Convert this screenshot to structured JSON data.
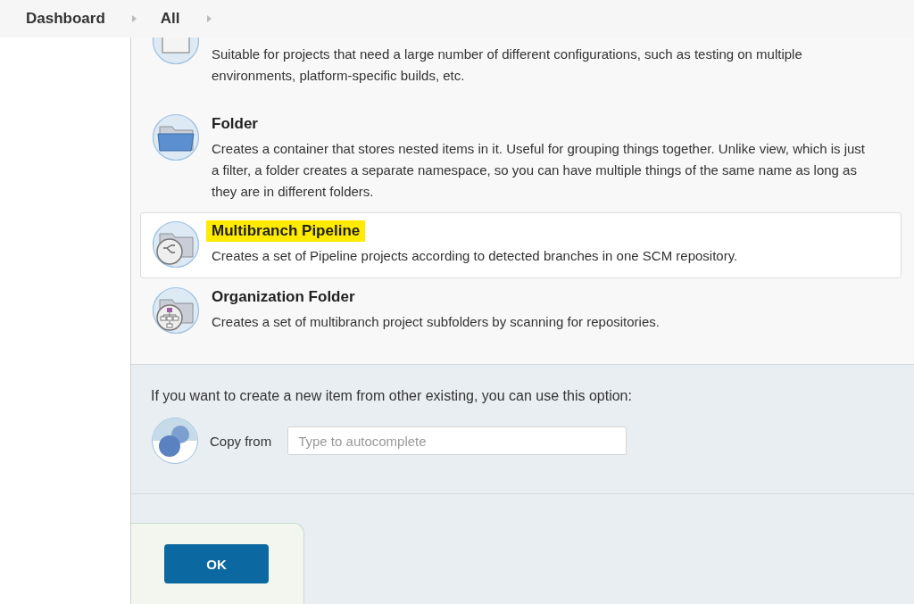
{
  "breadcrumb": [
    {
      "label": "Dashboard"
    },
    {
      "label": "All"
    }
  ],
  "items": [
    {
      "kind": "matrix",
      "description": "Suitable for projects that need a large number of different configurations, such as testing on multiple environments, platform-specific builds, etc.",
      "selected": false
    },
    {
      "kind": "folder",
      "name": "Folder",
      "description": "Creates a container that stores nested items in it. Useful for grouping things together. Unlike view, which is just a filter, a folder creates a separate namespace, so you can have multiple things of the same name as long as they are in different folders.",
      "selected": false
    },
    {
      "kind": "multibranch",
      "name": "Multibranch Pipeline",
      "description": "Creates a set of Pipeline projects according to detected branches in one SCM repository.",
      "selected": true
    },
    {
      "kind": "organization",
      "name": "Organization Folder",
      "description": "Creates a set of multibranch project subfolders by scanning for repositories.",
      "selected": false
    }
  ],
  "copy": {
    "hint": "If you want to create a new item from other existing, you can use this option:",
    "label": "Copy from",
    "placeholder": "Type to autocomplete"
  },
  "ok_button": "OK"
}
